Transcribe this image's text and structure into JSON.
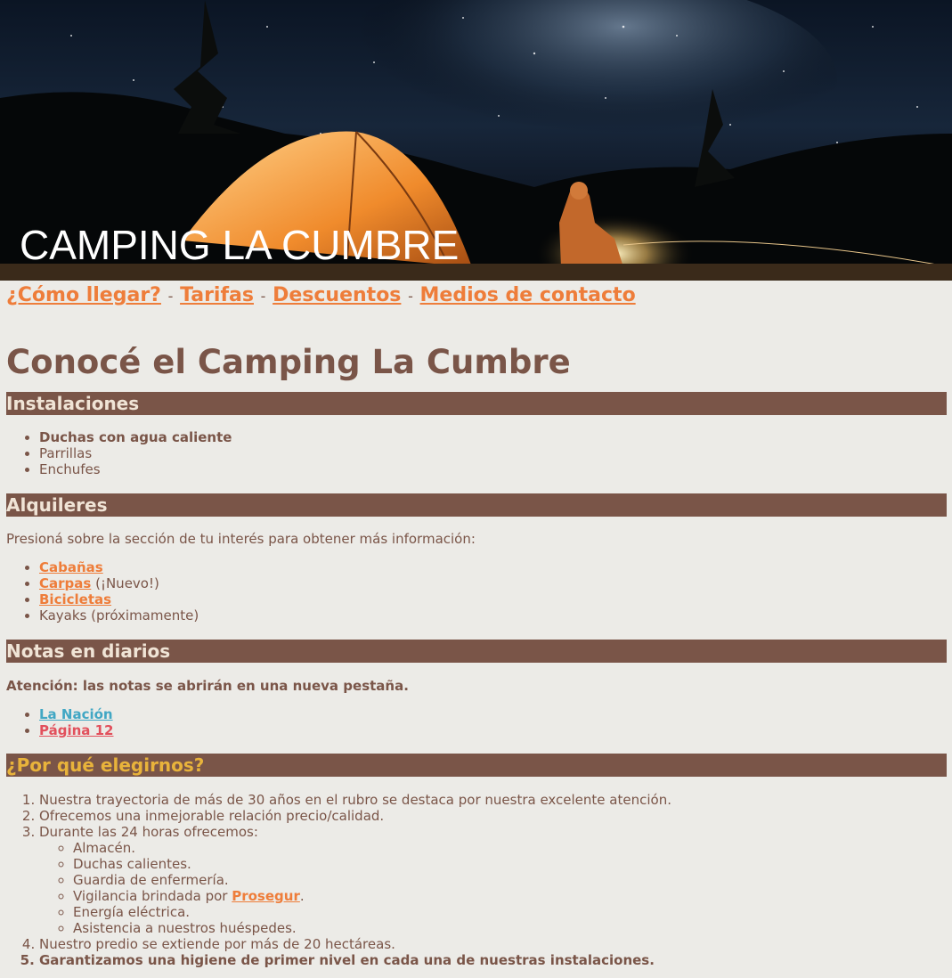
{
  "hero": {
    "title": "CAMPING LA CUMBRE"
  },
  "nav": [
    {
      "label": "¿Cómo llegar?"
    },
    {
      "label": "Tarifas"
    },
    {
      "label": "Descuentos"
    },
    {
      "label": "Medios de contacto"
    }
  ],
  "nav_separator": "-",
  "main_title": "Conocé el Camping La Cumbre",
  "instalaciones": {
    "heading": "Instalaciones",
    "items": [
      "Duchas con agua caliente",
      "Parrillas",
      "Enchufes"
    ]
  },
  "alquileres": {
    "heading": "Alquileres",
    "intro": "Presioná sobre la sección de tu interés para obtener más información:",
    "items": [
      {
        "link": "Cabañas",
        "suffix": ""
      },
      {
        "link": "Carpas",
        "suffix": " (¡Nuevo!)"
      },
      {
        "link": "Bicicletas",
        "suffix": ""
      },
      {
        "text": "Kayaks (próximamente)"
      }
    ]
  },
  "notas": {
    "heading": "Notas en diarios",
    "notice": "Atención: las notas se abrirán en una nueva pestaña.",
    "items": [
      "La Nación",
      "Página 12"
    ]
  },
  "porque": {
    "heading": "¿Por qué elegirnos?",
    "items": [
      "Nuestra trayectoria de más de 30 años en el rubro se destaca por nuestra excelente atención.",
      "Ofrecemos una inmejorable relación precio/calidad.",
      "Durante las 24 horas ofrecemos:",
      "Nuestro predio se extiende por más de 20 hectáreas.",
      "Garantizamos una higiene de primer nivel en cada una de nuestras instalaciones."
    ],
    "sub_items": [
      "Almacén.",
      "Duchas calientes.",
      "Guardia de enfermería.",
      "Energía eléctrica.",
      "Asistencia a nuestros huéspedes."
    ],
    "vigilancia": {
      "prefix": "Vigilancia brindada por ",
      "link": "Prosegur",
      "suffix": "."
    }
  },
  "colors": {
    "background": "#ecebe7",
    "brown": "#7a5548",
    "orange": "#ee7d3a",
    "gold": "#e8b33b",
    "blue": "#41a7c4",
    "red": "#e2505c"
  }
}
